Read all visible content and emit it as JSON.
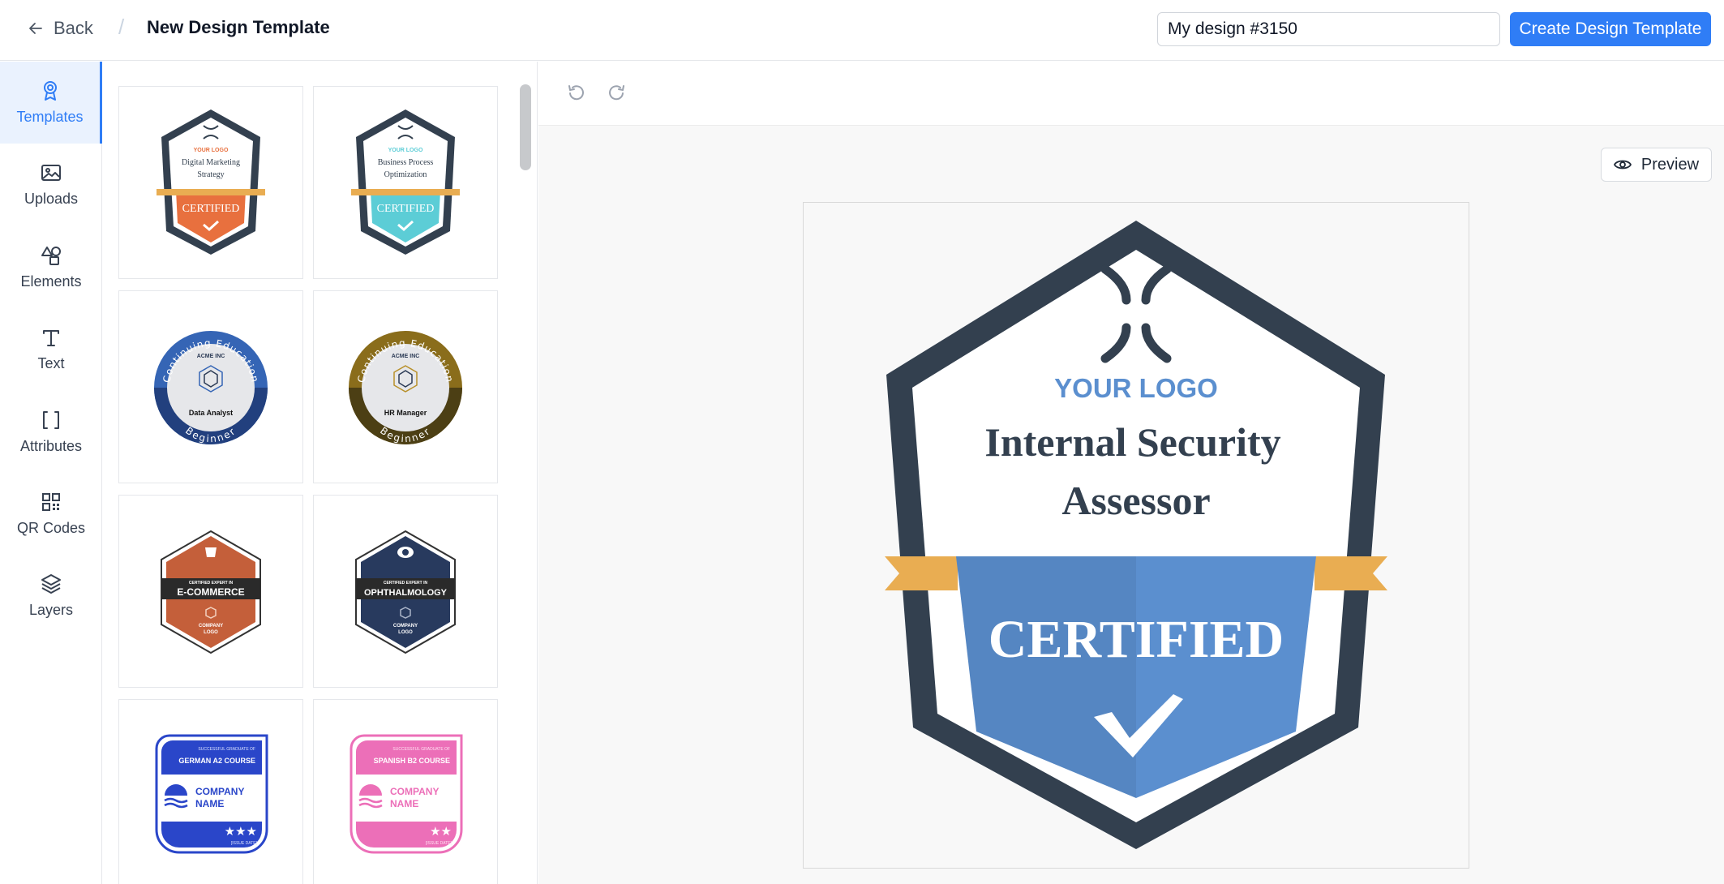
{
  "header": {
    "back_label": "Back",
    "separator": "/",
    "title": "New Design Template",
    "design_name_value": "My design #3150",
    "create_button_label": "Create Design Template"
  },
  "nav": {
    "items": [
      {
        "label": "Templates",
        "icon": "ribbon-icon",
        "active": true
      },
      {
        "label": "Uploads",
        "icon": "image-icon"
      },
      {
        "label": "Elements",
        "icon": "shapes-icon"
      },
      {
        "label": "Text",
        "icon": "text-icon"
      },
      {
        "label": "Attributes",
        "icon": "brackets-icon"
      },
      {
        "label": "QR Codes",
        "icon": "qr-code-icon"
      },
      {
        "label": "Layers",
        "icon": "layers-icon"
      }
    ]
  },
  "templates": [
    {
      "logo": "YOUR LOGO",
      "line1": "Digital Marketing",
      "line2": "Strategy",
      "ribbon": "CERTIFIED",
      "accent": "#e8703e"
    },
    {
      "logo": "YOUR LOGO",
      "line1": "Business Process",
      "line2": "Optimization",
      "ribbon": "CERTIFIED",
      "accent": "#5ccdd6"
    },
    {
      "top_arc": "Continuing Education",
      "company": "ACME INC",
      "name": "Data Analyst",
      "bottom_arc": "Beginner",
      "accent": "#3565b5"
    },
    {
      "top_arc": "Continuing Education",
      "company": "ACME INC",
      "name": "HR Manager",
      "bottom_arc": "Beginner",
      "accent": "#8a6d1b"
    },
    {
      "sub": "CERTIFIED EXPERT IN",
      "title": "E-COMMERCE",
      "company_line1": "COMPANY",
      "company_line2": "LOGO",
      "accent": "#c45f3a"
    },
    {
      "sub": "CERTIFIED EXPERT IN",
      "title": "OPHTHALMOLOGY",
      "company_line1": "COMPANY",
      "company_line2": "LOGO",
      "accent": "#283a5e"
    },
    {
      "sub": "SUCCESSFUL GRADUATE OF",
      "title": "GERMAN A2 COURSE",
      "company_line1": "COMPANY",
      "company_line2": "NAME",
      "stars": "★★★",
      "date": "[ISSUE DATE]",
      "accent": "#2a46c9"
    },
    {
      "sub": "SUCCESSFUL GRADUATE OF",
      "title": "SPANISH B2 COURSE",
      "company_line1": "COMPANY",
      "company_line2": "NAME",
      "stars": "★★",
      "date": "[ISSUE DATE]",
      "accent": "#ec6fb8"
    }
  ],
  "canvas": {
    "preview_label": "Preview",
    "badge": {
      "logo_text": "YOUR LOGO",
      "title_line1": "Internal Security",
      "title_line2": "Assessor",
      "ribbon_text": "CERTIFIED",
      "frame_color": "#33404f",
      "shield_color": "#5b8fcf",
      "ribbon_color": "#e9ad52",
      "logo_color": "#5b8fcf"
    }
  }
}
